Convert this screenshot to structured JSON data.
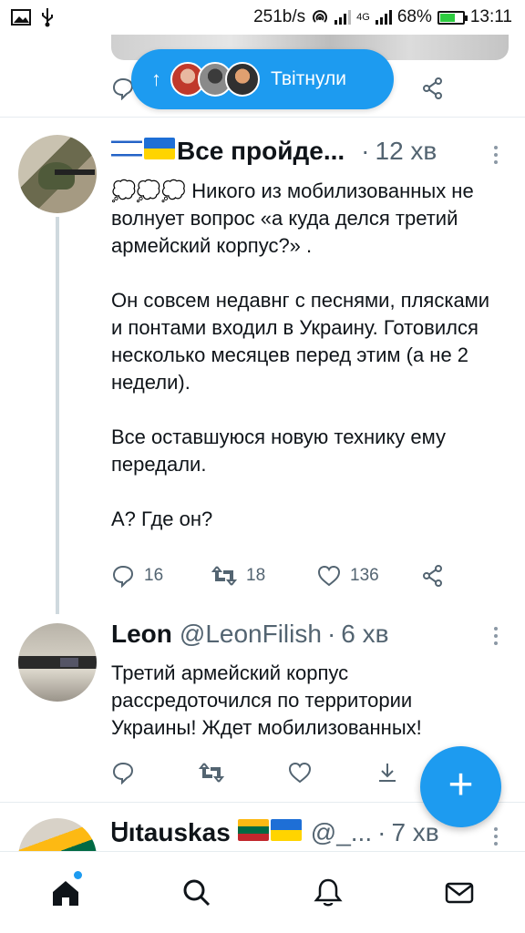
{
  "status_bar": {
    "net_speed": "251b/s",
    "network_type": "4G",
    "battery": "68%",
    "time": "13:11"
  },
  "new_tweets_pill": {
    "label": "Твітнули"
  },
  "tweets": [
    {
      "name": "Все пройде...",
      "time": "12 хв",
      "body": "💭💭💭 Никого из мобилизованных не волнует вопрос «а куда делся третий армейский корпус?» .\n\nОн совсем недавнг с песнями, плясками и понтами входил в Украину. Готовился несколько месяцев перед этим (а не 2 недели).\n\nВсе оставшуюся новую технику ему передали.\n\nА? Где он?",
      "replies": "16",
      "retweets": "18",
      "likes": "136"
    },
    {
      "name": "Leon",
      "handle": "@LeonFilish",
      "time": "6 хв",
      "body": "Третий армейский корпус рассредоточился по территории Украины! Ждет мобилизованных!"
    },
    {
      "name": "Ꮜıtauskas",
      "handle": "@_...",
      "time": "7 хв"
    }
  ],
  "colors": {
    "accent": "#1d9bf0",
    "muted": "#536471",
    "text": "#0f1419"
  },
  "icons": [
    "home-icon",
    "search-icon",
    "notifications-icon",
    "messages-icon",
    "compose-icon",
    "reply-icon",
    "retweet-icon",
    "like-icon",
    "share-icon"
  ]
}
